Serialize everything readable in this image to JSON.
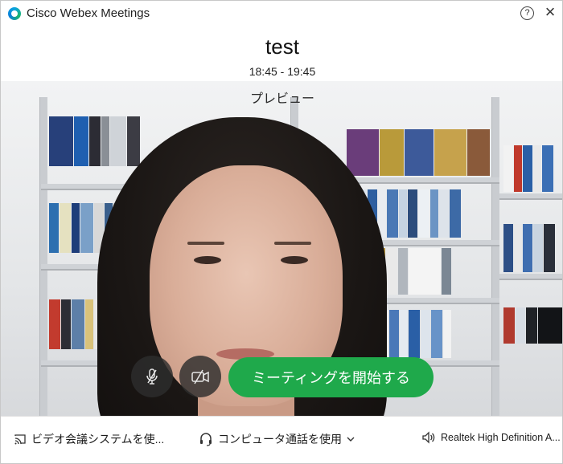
{
  "window": {
    "app_title": "Cisco Webex Meetings",
    "help_label": "?",
    "close_label": "×"
  },
  "meeting": {
    "name": "test",
    "time_range": "18:45 - 19:45"
  },
  "preview": {
    "label": "プレビュー"
  },
  "controls": {
    "mute_icon": "microphone-off-icon",
    "video_icon": "video-off-icon",
    "start_button_label": "ミーティングを開始する",
    "start_button_color": "#1fa94b"
  },
  "bottom_bar": {
    "video_system_label": "ビデオ会議システムを使...",
    "audio_option_label": "コンピュータ通話を使用",
    "speaker_label": "Realtek High Definition A..."
  }
}
